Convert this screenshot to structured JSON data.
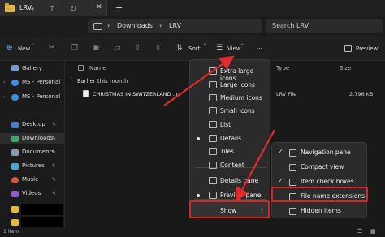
{
  "tab": {
    "title": "LRV",
    "close": "✕",
    "add": "+"
  },
  "address": {
    "crumb1": "Downloads",
    "sep": "›",
    "crumb2": "LRV",
    "sep2": "›"
  },
  "search": {
    "placeholder": "Search LRV"
  },
  "commands": {
    "new": "New",
    "sort": "Sort",
    "view": "View",
    "more": "···",
    "preview": "Preview"
  },
  "sidebar": {
    "gallery": "Gallery",
    "ms1": "MS - Personal",
    "ms2": "MS - Personal",
    "desktop": "Desktop",
    "downloads": "Downloads",
    "documents": "Documents",
    "pictures": "Pictures",
    "music": "Music",
    "videos": "Videos"
  },
  "columns": {
    "name": "Name",
    "type": "Type",
    "size": "Size"
  },
  "group": "Earlier this month",
  "file": {
    "name": "CHRISTMAS IN SWITZERLAND .lrv",
    "type": "LRV File",
    "size": "2,796 KB"
  },
  "status": "1 item",
  "view_menu": {
    "items": [
      "Extra large icons",
      "Large icons",
      "Medium icons",
      "Small icons",
      "List",
      "Details",
      "Tiles",
      "Content",
      "Details pane",
      "Preview pane",
      "Show"
    ],
    "show_chevron": "›"
  },
  "show_menu": {
    "items": [
      "Navigation pane",
      "Compact view",
      "Item check boxes",
      "File name extensions",
      "Hidden items"
    ]
  },
  "colors": {
    "accent": "#d6262a",
    "folder": "#e9b93c",
    "onedrive": "#3b8fe0"
  }
}
